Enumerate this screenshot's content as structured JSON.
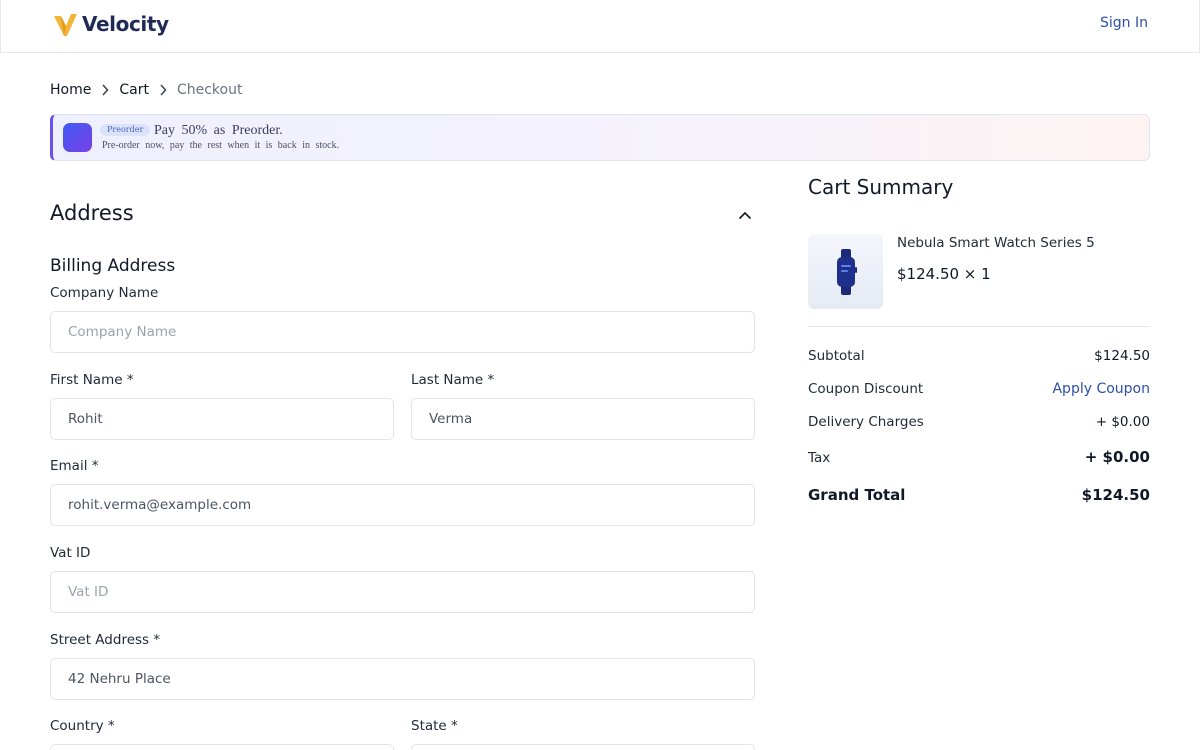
{
  "header": {
    "brand": "Velocity",
    "sign_in": "Sign In",
    "colors": {
      "brand_navy": "#1f2a56",
      "accent_gold": "#f2b53a",
      "link_blue": "#2f4fa6"
    }
  },
  "breadcrumb": {
    "items": [
      "Home",
      "Cart",
      "Checkout"
    ]
  },
  "banner": {
    "badge": "Preorder",
    "title": "Pay 50% as Preorder.",
    "subtitle": "Pre-order now, pay the rest when it is back in stock."
  },
  "form": {
    "section_title": "Address",
    "subsection_title": "Billing Address",
    "company": {
      "label": "Company Name",
      "placeholder": "Company Name",
      "value": ""
    },
    "first_name": {
      "label": "First Name *",
      "value": "Rohit"
    },
    "last_name": {
      "label": "Last Name *",
      "value": "Verma"
    },
    "email": {
      "label": "Email *",
      "value": "rohit.verma@example.com"
    },
    "vat": {
      "label": "Vat ID",
      "placeholder": "Vat ID",
      "value": ""
    },
    "street": {
      "label": "Street Address *",
      "value": "42 Nehru Place"
    },
    "country": {
      "label": "Country *"
    },
    "state": {
      "label": "State *"
    }
  },
  "cart": {
    "title": "Cart Summary",
    "product": {
      "name": "Nebula Smart Watch Series 5",
      "price_qty": "$124.50 × 1",
      "icon": "smartwatch-icon"
    },
    "subtotal": {
      "label": "Subtotal",
      "value": "$124.50"
    },
    "coupon": {
      "label": "Coupon Discount",
      "action": "Apply Coupon"
    },
    "delivery": {
      "label": "Delivery Charges",
      "value": "+ $0.00"
    },
    "tax": {
      "label": "Tax",
      "value": "+ $0.00"
    },
    "grand_total": {
      "label": "Grand Total",
      "value": "$124.50"
    }
  }
}
